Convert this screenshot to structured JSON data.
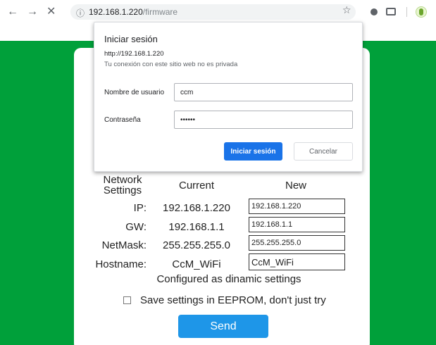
{
  "browser": {
    "back_icon": "←",
    "forward_icon": "→",
    "close_icon": "✕",
    "info_icon": "ⓘ",
    "url_host": "192.168.1.220",
    "url_path": "/firmware",
    "star_icon": "☆",
    "extensions": [
      "extension-dot-icon",
      "mail-icon",
      "evernote-icon"
    ]
  },
  "login_dialog": {
    "title": "Iniciar sesión",
    "url": "http://192.168.1.220",
    "warning": "Tu conexión con este sitio web no es privada",
    "username_label": "Nombre de usuario",
    "username_value": "ccm",
    "password_label": "Contraseña",
    "password_value": "••••••",
    "submit_label": "Iniciar sesión",
    "cancel_label": "Cancelar"
  },
  "network": {
    "headers": {
      "settings": "Network Settings",
      "current": "Current",
      "new": "New"
    },
    "rows": [
      {
        "label": "IP:",
        "current": "192.168.1.220",
        "new": "192.168.1.220"
      },
      {
        "label": "GW:",
        "current": "192.168.1.1",
        "new": "192.168.1.1"
      },
      {
        "label": "NetMask:",
        "current": "255.255.255.0",
        "new": "255.255.255.0"
      },
      {
        "label": "Hostname:",
        "current": "CcM_WiFi",
        "new": "CcM_WiFi"
      }
    ],
    "note": "Configured as dinamic settings",
    "save_checkbox_label": "Save settings in EEPROM, don't just try",
    "save_checked": false,
    "send_label": "Send"
  },
  "colors": {
    "page_background": "#00a03a",
    "send_button": "#1e96e8",
    "primary_button": "#1a73e8"
  }
}
